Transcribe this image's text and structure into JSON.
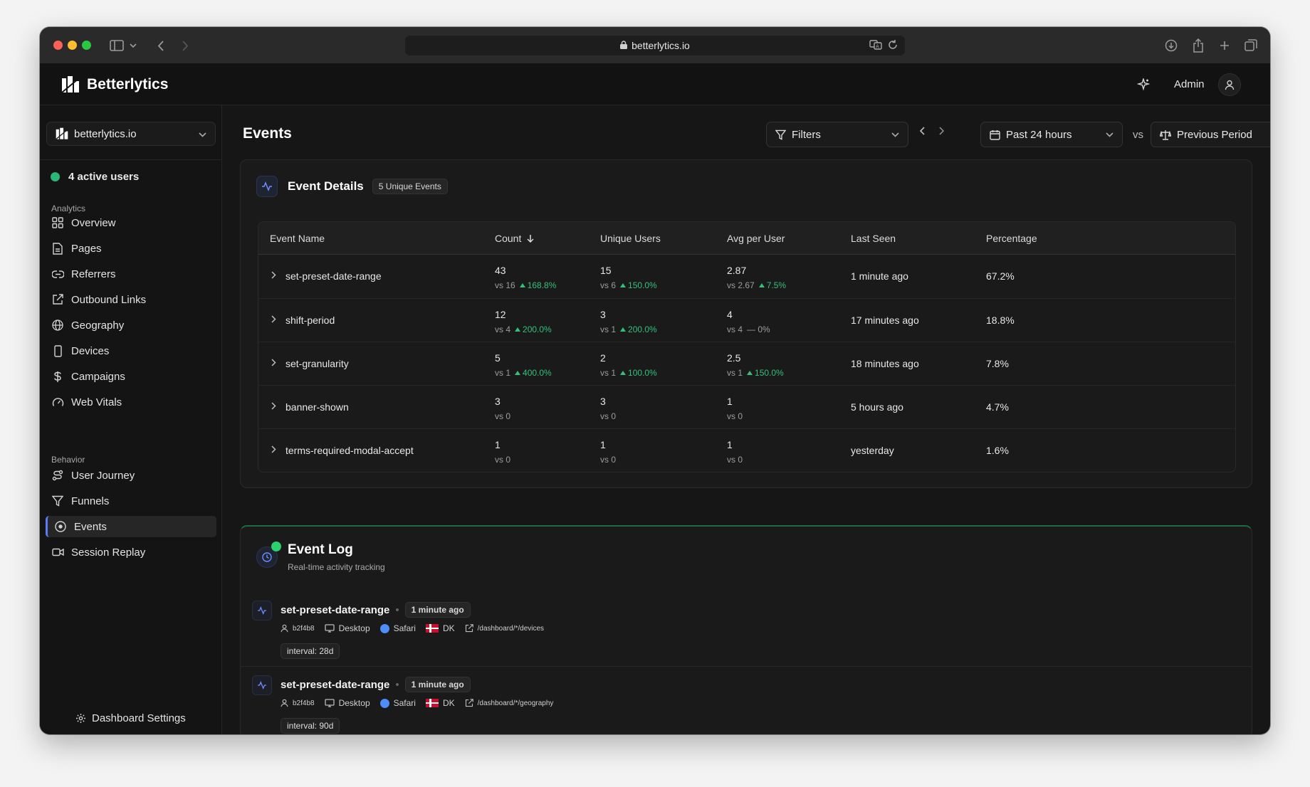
{
  "browser": {
    "url": "betterlytics.io"
  },
  "header": {
    "brand": "Betterlytics",
    "user": "Admin"
  },
  "sidebar": {
    "site": "betterlytics.io",
    "active_users": "4 active users",
    "section_analytics": "Analytics",
    "section_behavior": "Behavior",
    "analytics_items": [
      {
        "label": "Overview",
        "icon": "grid-icon"
      },
      {
        "label": "Pages",
        "icon": "file-icon"
      },
      {
        "label": "Referrers",
        "icon": "link-icon"
      },
      {
        "label": "Outbound Links",
        "icon": "external-link-icon"
      },
      {
        "label": "Geography",
        "icon": "globe-icon"
      },
      {
        "label": "Devices",
        "icon": "smartphone-icon"
      },
      {
        "label": "Campaigns",
        "icon": "dollar-icon"
      },
      {
        "label": "Web Vitals",
        "icon": "gauge-icon"
      }
    ],
    "behavior_items": [
      {
        "label": "User Journey",
        "icon": "route-icon"
      },
      {
        "label": "Funnels",
        "icon": "funnel-icon"
      },
      {
        "label": "Events",
        "icon": "target-icon"
      },
      {
        "label": "Session Replay",
        "icon": "video-icon"
      }
    ],
    "settings": "Dashboard Settings"
  },
  "main": {
    "title": "Events",
    "filters": "Filters",
    "range": "Past 24 hours",
    "vs": "vs",
    "compare": "Previous Period"
  },
  "details": {
    "title": "Event Details",
    "badge": "5 Unique Events",
    "columns": [
      "Event Name",
      "Count",
      "Unique Users",
      "Avg per User",
      "Last Seen",
      "Percentage"
    ],
    "rows": [
      {
        "name": "set-preset-date-range",
        "count": "43",
        "count_vs": "vs 16",
        "count_delta": "168.8%",
        "users": "15",
        "users_vs": "vs 6",
        "users_delta": "150.0%",
        "avg": "2.87",
        "avg_vs": "vs 2.67",
        "avg_delta": "7.5%",
        "last": "1 minute ago",
        "pct": "67.2%"
      },
      {
        "name": "shift-period",
        "count": "12",
        "count_vs": "vs 4",
        "count_delta": "200.0%",
        "users": "3",
        "users_vs": "vs 1",
        "users_delta": "200.0%",
        "avg": "4",
        "avg_vs": "vs 4",
        "avg_delta": "— 0%",
        "last": "17 minutes ago",
        "pct": "18.8%"
      },
      {
        "name": "set-granularity",
        "count": "5",
        "count_vs": "vs 1",
        "count_delta": "400.0%",
        "users": "2",
        "users_vs": "vs 1",
        "users_delta": "100.0%",
        "avg": "2.5",
        "avg_vs": "vs 1",
        "avg_delta": "150.0%",
        "last": "18 minutes ago",
        "pct": "7.8%"
      },
      {
        "name": "banner-shown",
        "count": "3",
        "count_vs": "vs 0",
        "users": "3",
        "users_vs": "vs 0",
        "avg": "1",
        "avg_vs": "vs 0",
        "last": "5 hours ago",
        "pct": "4.7%"
      },
      {
        "name": "terms-required-modal-accept",
        "count": "1",
        "count_vs": "vs 0",
        "users": "1",
        "users_vs": "vs 0",
        "avg": "1",
        "avg_vs": "vs 0",
        "last": "yesterday",
        "pct": "1.6%"
      }
    ]
  },
  "log": {
    "title": "Event Log",
    "subtitle": "Real-time activity tracking",
    "entries": [
      {
        "name": "set-preset-date-range",
        "time": "1 minute ago",
        "visitor": "b2f4b8",
        "device": "Desktop",
        "browser": "Safari",
        "country": "DK",
        "path": "/dashboard/*/devices",
        "prop": "interval: 28d"
      },
      {
        "name": "set-preset-date-range",
        "time": "1 minute ago",
        "visitor": "b2f4b8",
        "device": "Desktop",
        "browser": "Safari",
        "country": "DK",
        "path": "/dashboard/*/geography",
        "prop": "interval: 90d"
      }
    ]
  },
  "colors": {
    "accent": "#5b7cf6",
    "positive": "#34c07a",
    "live": "#2bd16f"
  }
}
